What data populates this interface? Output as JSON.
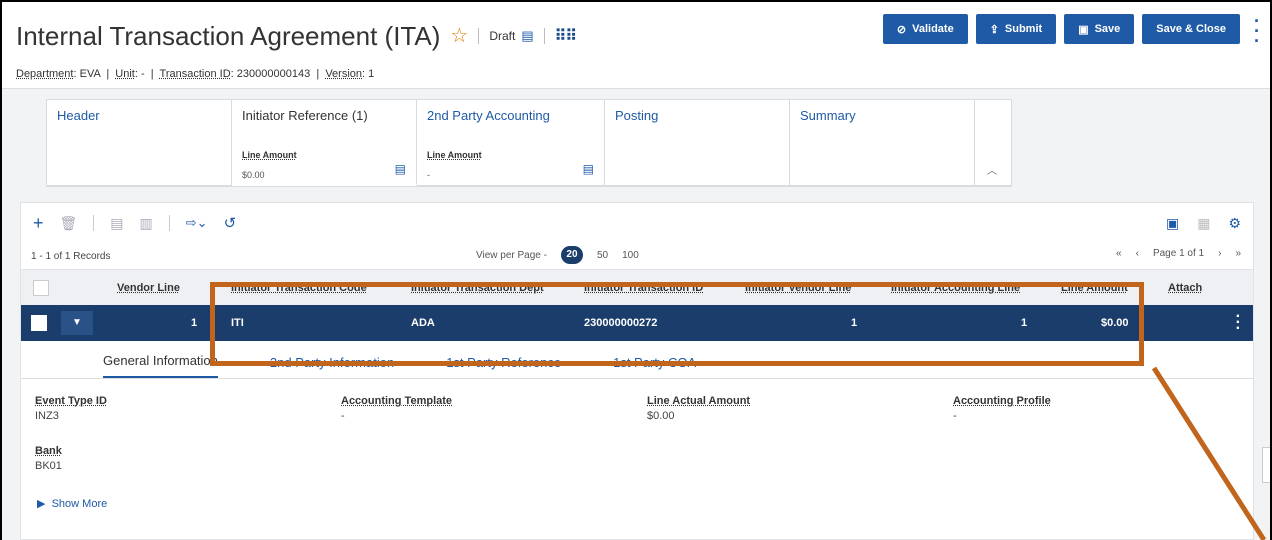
{
  "header": {
    "title": "Internal Transaction Agreement (ITA)",
    "status": "Draft",
    "buttons": {
      "validate": "Validate",
      "submit": "Submit",
      "save": "Save",
      "save_close": "Save & Close"
    },
    "meta": {
      "department_label": "Department",
      "department_value": "EVA",
      "unit_label": "Unit",
      "unit_value": "-",
      "transaction_id_label": "Transaction ID",
      "transaction_id_value": "230000000143",
      "version_label": "Version",
      "version_value": "1"
    }
  },
  "tabs": [
    {
      "title": "Header",
      "sub_label": "",
      "sub_value": ""
    },
    {
      "title": "Initiator Reference (1)",
      "sub_label": "Line Amount",
      "sub_value": "$0.00"
    },
    {
      "title": "2nd Party Accounting",
      "sub_label": "Line Amount",
      "sub_value": "-"
    },
    {
      "title": "Posting",
      "sub_label": "",
      "sub_value": ""
    },
    {
      "title": "Summary",
      "sub_label": "",
      "sub_value": ""
    }
  ],
  "grid": {
    "records": "1 - 1 of 1 Records",
    "view_per_page_label": "View per Page -",
    "page_sizes": [
      "20",
      "50",
      "100"
    ],
    "page_label": "Page 1 of 1",
    "columns": [
      "Vendor Line",
      "Initiator Transaction Code",
      "Initiator Transaction Dept",
      "Initiator Transaction ID",
      "Initiator Vendor Line",
      "Initiator Accounting Line",
      "Line Amount",
      "Attach"
    ],
    "rows": [
      {
        "vendor_line": "1",
        "code": "ITI",
        "dept": "ADA",
        "txn_id": "230000000272",
        "vendor_line_init": "1",
        "acct_line": "1",
        "amount": "$0.00"
      }
    ]
  },
  "detail": {
    "subtabs": [
      "General Information",
      "2nd Party Information",
      "1st Party Reference",
      "1st Party COA"
    ],
    "fields": [
      {
        "label": "Event Type ID",
        "value": "INZ3"
      },
      {
        "label": "Accounting Template",
        "value": "-"
      },
      {
        "label": "Line Actual Amount",
        "value": "$0.00"
      },
      {
        "label": "Accounting Profile",
        "value": "-"
      },
      {
        "label": "Bank",
        "value": "BK01"
      }
    ],
    "show_more": "Show More"
  },
  "colors": {
    "primary": "#1f5aa6",
    "row_selected": "#1a3d6b",
    "highlight": "#c0651b",
    "star": "#e07b00"
  }
}
